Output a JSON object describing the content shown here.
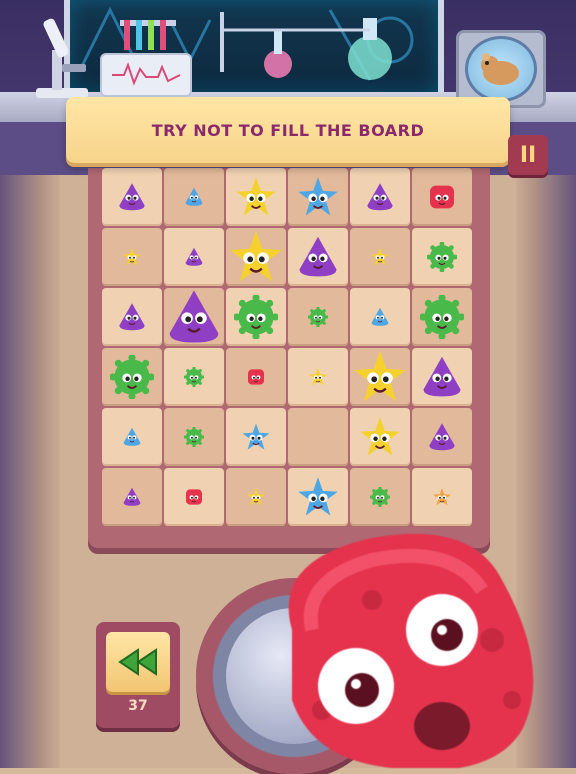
{
  "banner": {
    "text": "TRY NOT TO FILL THE BOARD"
  },
  "pause": {
    "icon": "pause-icon",
    "label": "II"
  },
  "rewind": {
    "icon": "rewind-icon",
    "count": "37"
  },
  "colors": {
    "purple": "#8e3fc4",
    "yellow": "#f5d12e",
    "blue": "#4fa6e4",
    "green": "#49b94a",
    "red": "#e5334e",
    "orange": "#f1a142"
  },
  "board": {
    "rows": [
      [
        {
          "m": "purple-blob",
          "s": "m"
        },
        {
          "m": "blue-blob",
          "s": "s"
        },
        {
          "m": "yellow-star",
          "s": "l"
        },
        {
          "m": "blue-star",
          "s": "l"
        },
        {
          "m": "purple-blob",
          "s": "m"
        },
        {
          "m": "red-square",
          "s": "m"
        }
      ],
      [
        {
          "m": "yellow-star",
          "s": "s"
        },
        {
          "m": "purple-blob",
          "s": "s"
        },
        {
          "m": "yellow-star",
          "s": "xl"
        },
        {
          "m": "purple-blob",
          "s": "l"
        },
        {
          "m": "yellow-star",
          "s": "s"
        },
        {
          "m": "green-germ",
          "s": "m"
        }
      ],
      [
        {
          "m": "purple-blob",
          "s": "m"
        },
        {
          "m": "purple-blob",
          "s": "xl"
        },
        {
          "m": "green-germ",
          "s": "l"
        },
        {
          "m": "green-germ",
          "s": "s"
        },
        {
          "m": "blue-blob",
          "s": "s"
        },
        {
          "m": "green-germ",
          "s": "l"
        }
      ],
      [
        {
          "m": "green-germ",
          "s": "l"
        },
        {
          "m": "green-germ",
          "s": "s"
        },
        {
          "m": "red-square",
          "s": "s"
        },
        {
          "m": "yellow-star",
          "s": "s"
        },
        {
          "m": "yellow-star",
          "s": "xl"
        },
        {
          "m": "purple-blob",
          "s": "l"
        }
      ],
      [
        {
          "m": "blue-blob",
          "s": "s"
        },
        {
          "m": "green-germ",
          "s": "s"
        },
        {
          "m": "blue-star",
          "s": "m"
        },
        {
          "m": "empty",
          "s": "none"
        },
        {
          "m": "yellow-star",
          "s": "l"
        },
        {
          "m": "purple-blob",
          "s": "m"
        }
      ],
      [
        {
          "m": "purple-blob",
          "s": "s"
        },
        {
          "m": "red-square",
          "s": "s"
        },
        {
          "m": "yellow-star",
          "s": "s"
        },
        {
          "m": "blue-star",
          "s": "l"
        },
        {
          "m": "green-germ",
          "s": "s"
        },
        {
          "m": "orange-star",
          "s": "s"
        }
      ]
    ]
  },
  "current_piece": {
    "monster": "red-square",
    "size": "huge"
  }
}
